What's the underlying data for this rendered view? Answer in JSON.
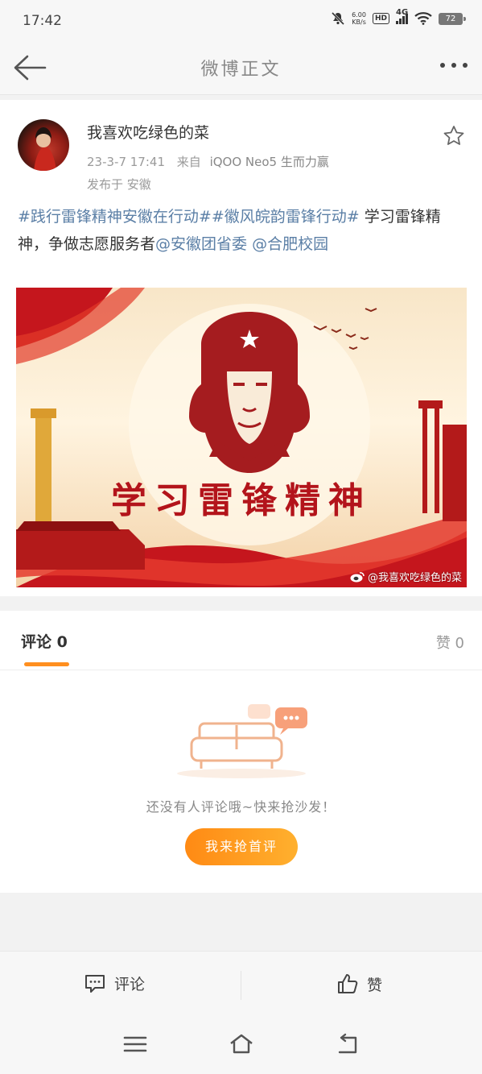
{
  "status": {
    "time": "17:42",
    "net_speed_top": "6.00",
    "net_speed_bottom": "KB/s",
    "hd": "HD",
    "network": "4G",
    "battery": "72"
  },
  "header": {
    "title": "微博正文"
  },
  "post": {
    "username": "我喜欢吃绿色的菜",
    "time": "23-3-7 17:41",
    "source_prefix": "来自",
    "source": "iQOO Neo5 生而力赢",
    "location": "发布于 安徽",
    "content": {
      "hashtag1": "#践行雷锋精神安徽在行动#",
      "hashtag2": "#徽风皖韵雷锋行动#",
      "text": " 学习雷锋精神，争做志愿服务者",
      "mention1": "@安徽团省委",
      "mention2": "@合肥校园"
    },
    "image": {
      "headline": "学习雷锋精神",
      "watermark": "@我喜欢吃绿色的菜"
    }
  },
  "tabs": {
    "comments_label": "评论 0",
    "likes_label": "赞 0"
  },
  "empty": {
    "message": "还没有人评论哦~快来抢沙发！",
    "button": "我来抢首评"
  },
  "actions": {
    "comment": "评论",
    "like": "赞"
  },
  "colors": {
    "accent": "#ff8f1f",
    "link": "#5b7fa6"
  }
}
